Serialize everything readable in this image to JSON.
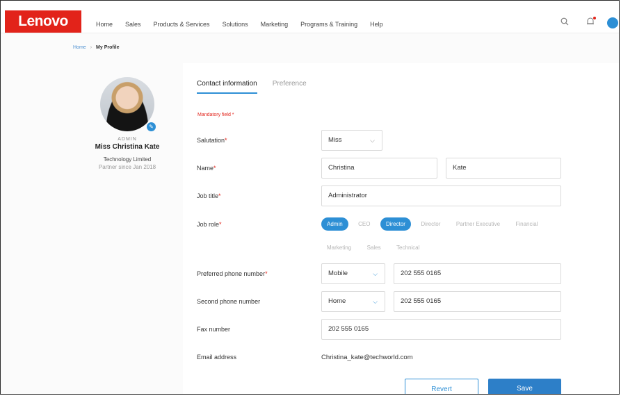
{
  "brand": {
    "logo_text": "Lenovo",
    "accent": "#e2231a",
    "primary": "#2d8fd5"
  },
  "nav": [
    "Home",
    "Sales",
    "Products & Services",
    "Solutions",
    "Marketing",
    "Programs & Training",
    "Help"
  ],
  "breadcrumb": {
    "home": "Home",
    "current": "My Profile"
  },
  "profile": {
    "role": "ADMIN",
    "name": "Miss Christina Kate",
    "company": "Technology Limited",
    "partner_since": "Partner since Jan 2018"
  },
  "tabs": [
    "Contact information",
    "Preference"
  ],
  "mandatory": "Mandatory field *",
  "form": {
    "salutation": {
      "label": "Salutation",
      "value": "Miss"
    },
    "name": {
      "label": "Name",
      "first": "Christina",
      "last": "Kate"
    },
    "job_title": {
      "label": "Job title",
      "value": "Administrator"
    },
    "job_role": {
      "label": "Job role",
      "options": [
        "Admin",
        "CEO",
        "Director",
        "Director",
        "Partner Executive",
        "Financial",
        "Marketing",
        "Sales",
        "Technical"
      ],
      "selected": [
        true,
        false,
        true,
        false,
        false,
        false,
        false,
        false,
        false
      ]
    },
    "preferred_phone": {
      "label": "Preferred phone number",
      "type": "Mobile",
      "value": "202 555 0165"
    },
    "second_phone": {
      "label": "Second phone number",
      "type": "Home",
      "value": "202 555 0165"
    },
    "fax": {
      "label": "Fax number",
      "value": "202 555 0165"
    },
    "email": {
      "label": "Email address",
      "value": "Christina_kate@techworld.com"
    }
  },
  "buttons": {
    "revert": "Revert",
    "save": "Save"
  }
}
